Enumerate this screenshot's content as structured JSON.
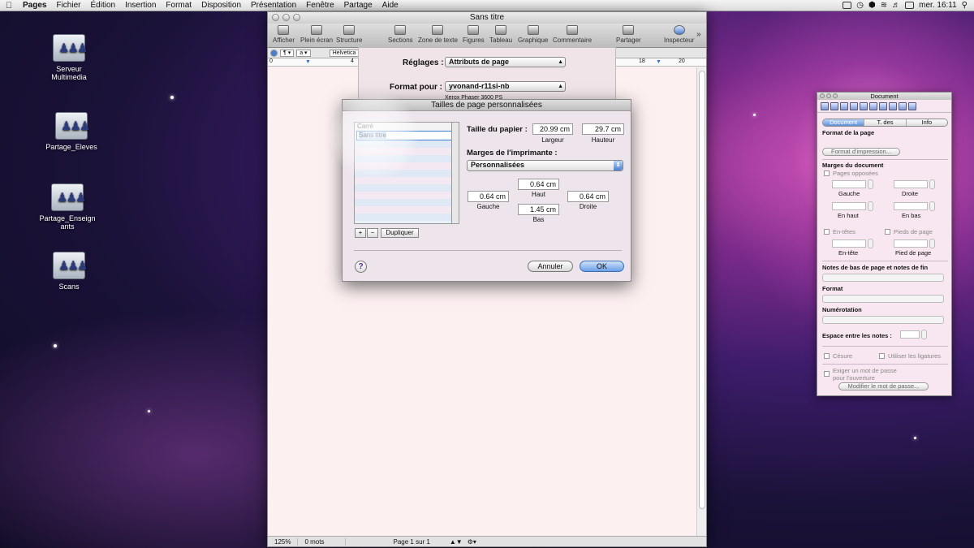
{
  "menubar": {
    "app": "Pages",
    "items": [
      "Fichier",
      "Édition",
      "Insertion",
      "Format",
      "Disposition",
      "Présentation",
      "Fenêtre",
      "Partage",
      "Aide"
    ],
    "clock": "mer. 16:11"
  },
  "desktop": {
    "icons": [
      {
        "label": "Serveur Multimedia"
      },
      {
        "label": "Partage_Eleves"
      },
      {
        "label": "Partage_Enseignants"
      },
      {
        "label": "Scans"
      }
    ]
  },
  "window": {
    "title": "Sans titre",
    "toolbar": {
      "afficher": "Afficher",
      "plein_ecran": "Plein écran",
      "structure": "Structure",
      "sections": "Sections",
      "zone_de_texte": "Zone de texte",
      "figures": "Figures",
      "tableau": "Tableau",
      "graphique": "Graphique",
      "commentaire": "Commentaire",
      "partager": "Partager",
      "inspecteur": "Inspecteur"
    },
    "formatbar": {
      "font": "Helvetica"
    },
    "ruler": {
      "marks": [
        "0",
        "4",
        "18",
        "20"
      ]
    },
    "status": {
      "zoom": "125%",
      "words": "0 mots",
      "page": "Page 1 sur 1"
    }
  },
  "print_sheet": {
    "reglages_label": "Réglages :",
    "reglages_value": "Attributs de page",
    "format_label": "Format pour :",
    "format_value": "yvonand-r11si-nb",
    "printer_sub": "Xerox Phaser 3600 PS"
  },
  "dialog": {
    "title": "Tailles de page personnalisées",
    "list": {
      "items": [
        "Carré"
      ],
      "editing": "Sans titre"
    },
    "paper_label": "Taille du papier :",
    "width_value": "20.99 cm",
    "width_label": "Largeur",
    "height_value": "29.7 cm",
    "height_label": "Hauteur",
    "margins_label": "Marges de l'imprimante :",
    "margins_value": "Personnalisées",
    "top_value": "0.64 cm",
    "top_label": "Haut",
    "left_value": "0.64 cm",
    "left_label": "Gauche",
    "right_value": "0.64 cm",
    "right_label": "Droite",
    "bottom_value": "1.45 cm",
    "bottom_label": "Bas",
    "add": "+",
    "remove": "−",
    "duplicate": "Dupliquer",
    "help": "?",
    "cancel": "Annuler",
    "ok": "OK"
  },
  "inspector": {
    "title": "Document",
    "tabs": [
      "Document",
      "T. des matières",
      "Info"
    ],
    "format_page": "Format de la page",
    "format_impression_btn": "Format d'impression...",
    "marges_doc": "Marges du document",
    "pages_opposees": "Pages opposées",
    "gauche": "Gauche",
    "droite": "Droite",
    "en_haut": "En haut",
    "en_bas": "En bas",
    "en_tetes": "En-têtes",
    "pieds_de_page": "Pieds de page",
    "en_tete": "En-tête",
    "pied_de_page": "Pied de page",
    "notes": "Notes de bas de page et notes de fin",
    "format": "Format",
    "numerotation": "Numérotation",
    "espace": "Espace entre les notes :",
    "cesure": "Césure",
    "ligatures": "Utiliser les ligatures",
    "exiger": "Exiger un mot de passe",
    "pour_ouverture": "pour l'ouverture",
    "modifier_btn": "Modifier le mot de passe..."
  }
}
